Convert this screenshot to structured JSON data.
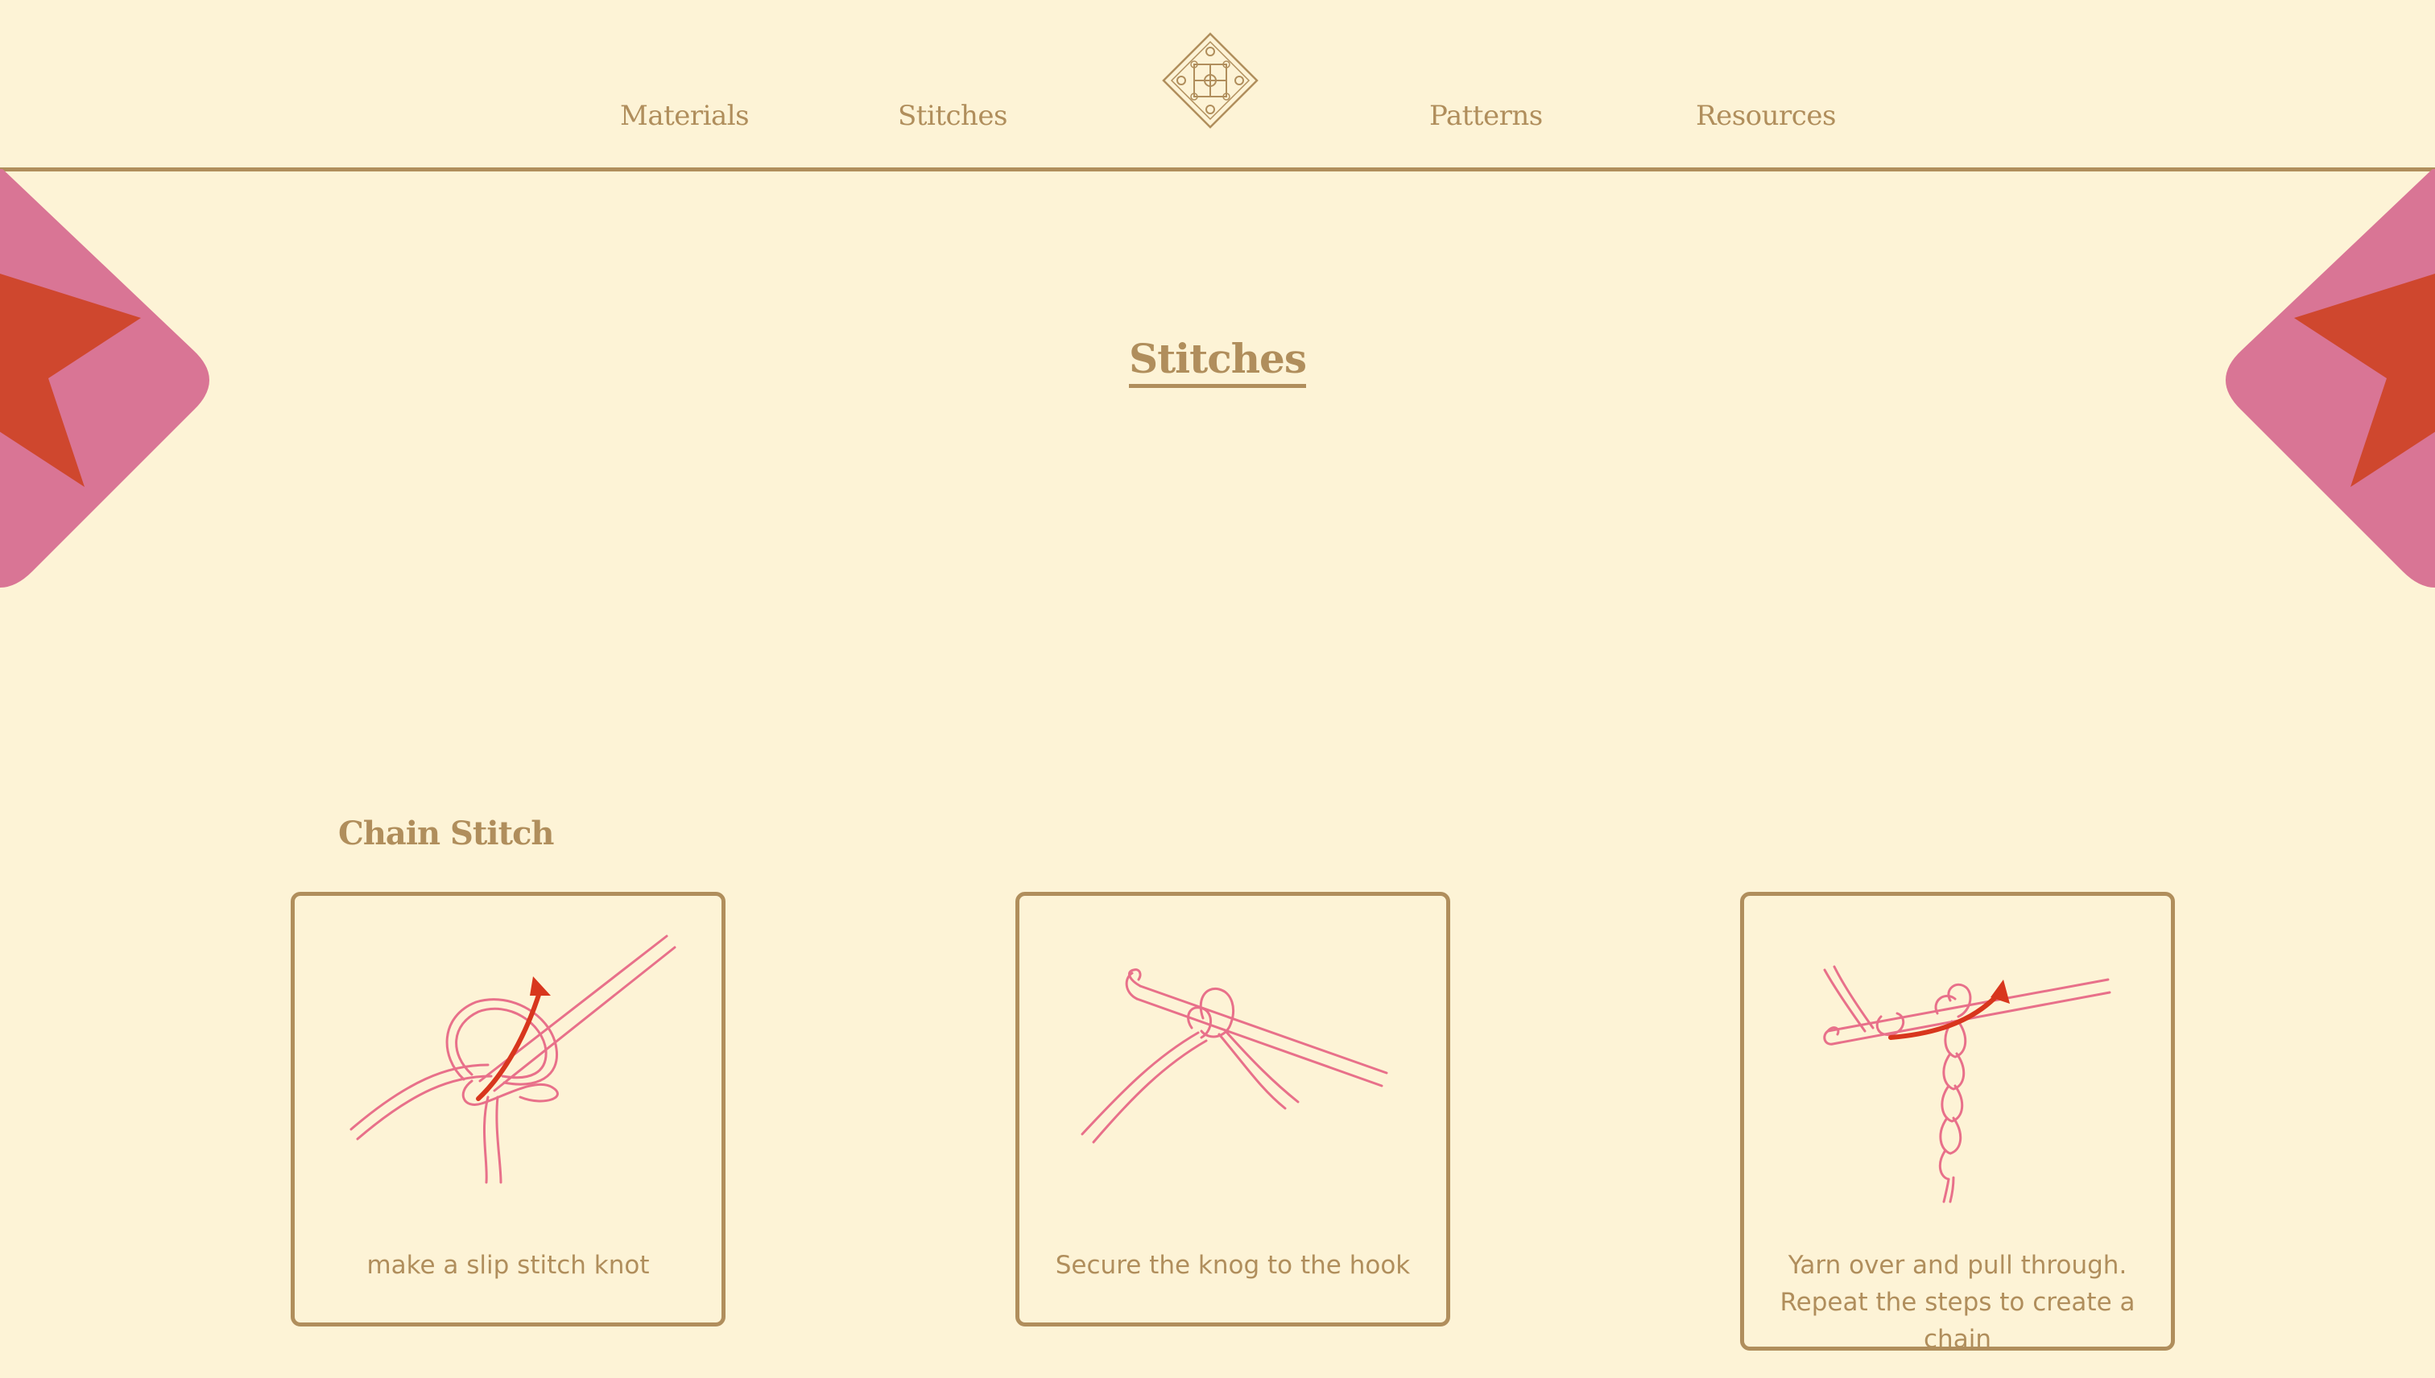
{
  "nav": {
    "items": [
      {
        "label": "Materials"
      },
      {
        "label": "Stitches"
      },
      {
        "label": "Patterns"
      },
      {
        "label": "Resources"
      }
    ]
  },
  "page": {
    "title": "Stitches"
  },
  "section": {
    "title": "Chain Stitch",
    "steps": [
      {
        "caption": "make a slip stitch knot"
      },
      {
        "caption": "Secure the knog to the hook"
      },
      {
        "caption": "Yarn over and pull through. Repeat the steps to create a chain"
      }
    ]
  },
  "colors": {
    "background": "#fdf3d6",
    "text": "#b08e5c",
    "yarn": "#e8708a",
    "arrow": "#d8361d",
    "corner_pink": "#d97595",
    "corner_star": "#cf472e"
  },
  "icons": {
    "logo": "granny-square-logo-icon",
    "corner_left": "star-tile-icon",
    "corner_right": "star-tile-icon"
  }
}
